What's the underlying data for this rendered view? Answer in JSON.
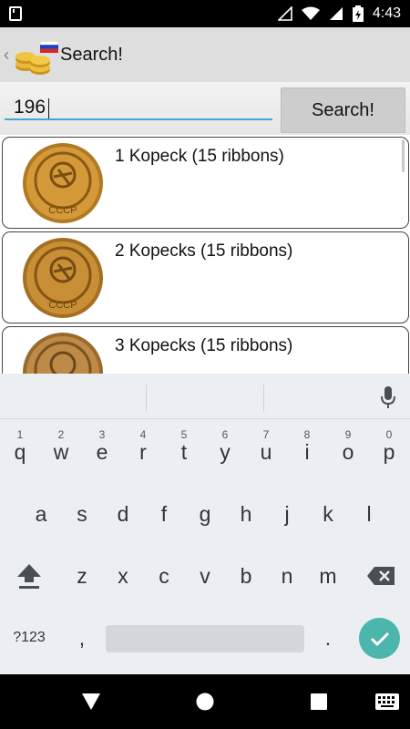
{
  "status": {
    "time": "4:43"
  },
  "app_bar": {
    "title": "Search!",
    "back_glyph": "‹"
  },
  "search": {
    "value": "196",
    "button_label": "Search!"
  },
  "results": [
    {
      "label": "1 Kopeck (15 ribbons)"
    },
    {
      "label": "2 Kopecks (15 ribbons)"
    },
    {
      "label": "3 Kopecks (15 ribbons)"
    }
  ],
  "coin_emblem_text": "СССР",
  "keyboard": {
    "row1": [
      "q",
      "w",
      "e",
      "r",
      "t",
      "y",
      "u",
      "i",
      "o",
      "p"
    ],
    "row1_hints": [
      "1",
      "2",
      "3",
      "4",
      "5",
      "6",
      "7",
      "8",
      "9",
      "0"
    ],
    "row2": [
      "a",
      "s",
      "d",
      "f",
      "g",
      "h",
      "j",
      "k",
      "l"
    ],
    "row3": [
      "z",
      "x",
      "c",
      "v",
      "b",
      "n",
      "m"
    ],
    "symbols_label": "?123",
    "comma": ",",
    "period": "."
  },
  "colors": {
    "accent": "#4aa3d8",
    "done_key": "#4db6ac",
    "app_bar": "#dedede",
    "keyboard_bg": "#eceff1"
  }
}
